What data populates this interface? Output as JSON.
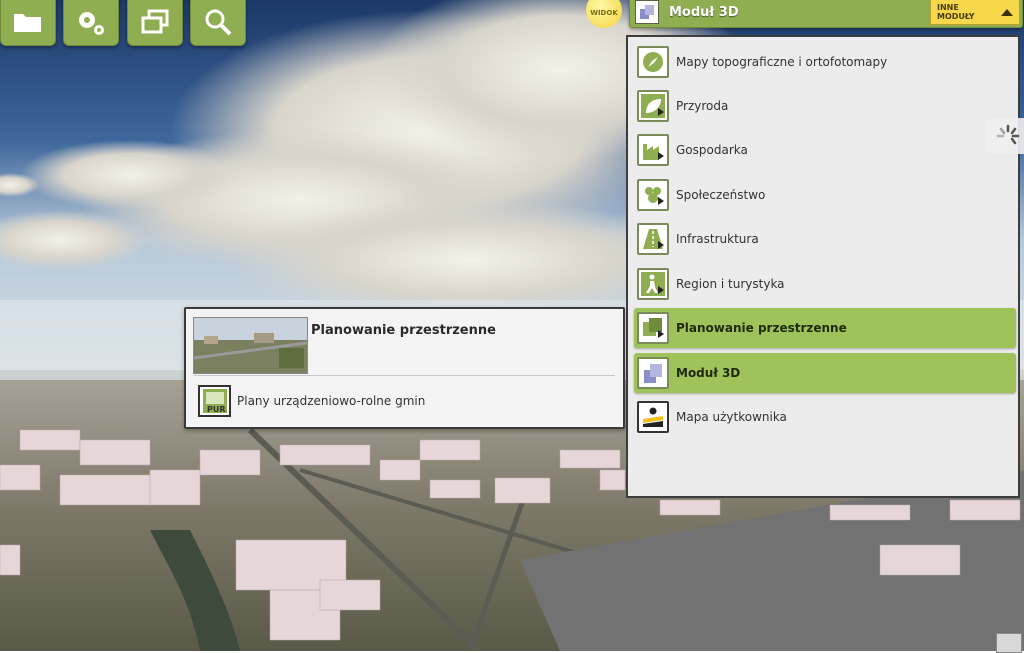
{
  "toolbar": {
    "buttons": [
      {
        "name": "folder-icon"
      },
      {
        "name": "settings-icon"
      },
      {
        "name": "windows-icon"
      },
      {
        "name": "search-icon"
      }
    ]
  },
  "widok": {
    "label": "WIDOK"
  },
  "module_bar": {
    "title": "Moduł 3D",
    "other_modules": "INNE MODUŁY"
  },
  "dropdown": {
    "items": [
      {
        "label": "Mapy topograficzne i ortofotomapy",
        "icon": "compass-icon",
        "active": false
      },
      {
        "label": "Przyroda",
        "icon": "leaf-icon",
        "active": false
      },
      {
        "label": "Gospodarka",
        "icon": "factory-icon",
        "active": false
      },
      {
        "label": "Społeczeństwo",
        "icon": "people-icon",
        "active": false
      },
      {
        "label": "Infrastruktura",
        "icon": "road-icon",
        "active": false
      },
      {
        "label": "Region i turystyka",
        "icon": "hiker-icon",
        "active": false
      },
      {
        "label": "Planowanie przestrzenne",
        "icon": "planning-icon",
        "active": true
      },
      {
        "label": "Moduł 3D",
        "icon": "cube-3d-icon",
        "active": true
      },
      {
        "label": "Mapa użytkownika",
        "icon": "user-map-icon",
        "active": false
      }
    ]
  },
  "submenu": {
    "title": "Planowanie przestrzenne",
    "items": [
      {
        "label": "Plany urządzeniowo-rolne gmin",
        "icon": "pur-icon"
      }
    ]
  },
  "colors": {
    "green": "#8fae52",
    "green_active": "#9fc25b",
    "yellow": "#f7d84a"
  }
}
